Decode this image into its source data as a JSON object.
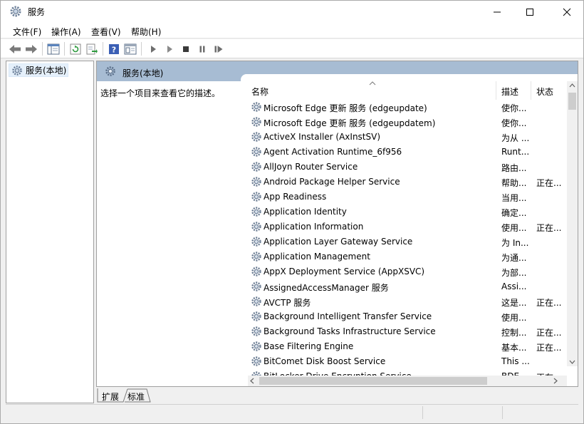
{
  "window": {
    "title": "服务"
  },
  "menu": {
    "items": [
      "文件(F)",
      "操作(A)",
      "查看(V)",
      "帮助(H)"
    ]
  },
  "toolbar": {
    "icons": [
      "back-arrow-icon",
      "forward-arrow-icon",
      "show-hide-tree-icon",
      "refresh-icon",
      "export-list-icon",
      "help-icon",
      "properties-icon",
      "start-service-icon",
      "start-service-alt-icon",
      "stop-service-icon",
      "pause-service-icon",
      "restart-service-icon"
    ]
  },
  "tree": {
    "root_label": "服务(本地)"
  },
  "right_header": {
    "label": "服务(本地)"
  },
  "description_prompt": "选择一个项目来查看它的描述。",
  "columns": {
    "name": "名称",
    "description": "描述",
    "state": "状态"
  },
  "services": [
    {
      "name": "Microsoft Edge 更新 服务 (edgeupdate)",
      "desc": "使你...",
      "state": ""
    },
    {
      "name": "Microsoft Edge 更新 服务 (edgeupdatem)",
      "desc": "使你...",
      "state": ""
    },
    {
      "name": "ActiveX Installer (AxInstSV)",
      "desc": "为从 ...",
      "state": ""
    },
    {
      "name": "Agent Activation Runtime_6f956",
      "desc": "Runt...",
      "state": ""
    },
    {
      "name": "AllJoyn Router Service",
      "desc": "路由...",
      "state": ""
    },
    {
      "name": "Android Package Helper Service",
      "desc": "帮助...",
      "state": "正在..."
    },
    {
      "name": "App Readiness",
      "desc": "当用...",
      "state": ""
    },
    {
      "name": "Application Identity",
      "desc": "确定...",
      "state": ""
    },
    {
      "name": "Application Information",
      "desc": "使用...",
      "state": "正在..."
    },
    {
      "name": "Application Layer Gateway Service",
      "desc": "为 In...",
      "state": ""
    },
    {
      "name": "Application Management",
      "desc": "为通...",
      "state": ""
    },
    {
      "name": "AppX Deployment Service (AppXSVC)",
      "desc": "为部...",
      "state": ""
    },
    {
      "name": "AssignedAccessManager 服务",
      "desc": "Assi...",
      "state": ""
    },
    {
      "name": "AVCTP 服务",
      "desc": "这是...",
      "state": "正在..."
    },
    {
      "name": "Background Intelligent Transfer Service",
      "desc": "使用...",
      "state": ""
    },
    {
      "name": "Background Tasks Infrastructure Service",
      "desc": "控制...",
      "state": "正在..."
    },
    {
      "name": "Base Filtering Engine",
      "desc": "基本...",
      "state": "正在..."
    },
    {
      "name": "BitComet Disk Boost Service",
      "desc": "This ...",
      "state": ""
    },
    {
      "name": "BitLocker Drive Encryption Service",
      "desc": "BDE...",
      "state": "正在..."
    }
  ],
  "tabs": {
    "extended": "扩展",
    "standard": "标准"
  }
}
